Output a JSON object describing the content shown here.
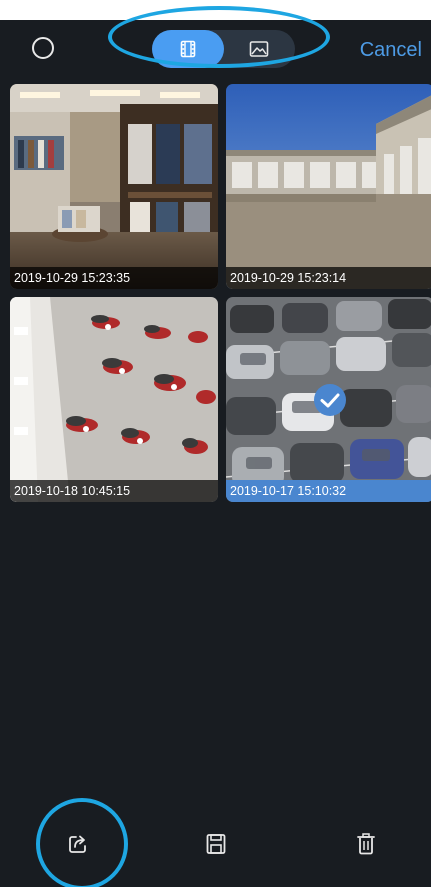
{
  "header": {
    "cancel_label": "Cancel",
    "tabs": [
      {
        "icon": "film-icon",
        "active": true
      },
      {
        "icon": "image-icon",
        "active": false
      }
    ]
  },
  "colors": {
    "accent": "#4a9df2",
    "highlight": "#1ea6e2",
    "background": "#181c21"
  },
  "gallery": {
    "items": [
      {
        "timestamp": "2019-10-29 15:23:35",
        "selected": false,
        "scene": "clothing-store"
      },
      {
        "timestamp": "2019-10-29 15:23:14",
        "selected": false,
        "scene": "garage-lot"
      },
      {
        "timestamp": "2019-10-18 10:45:15",
        "selected": false,
        "scene": "atrium-lounge"
      },
      {
        "timestamp": "2019-10-17 15:10:32",
        "selected": true,
        "scene": "parking-lot"
      }
    ]
  },
  "toolbar": {
    "icons": [
      "share-icon",
      "save-icon",
      "trash-icon"
    ]
  }
}
